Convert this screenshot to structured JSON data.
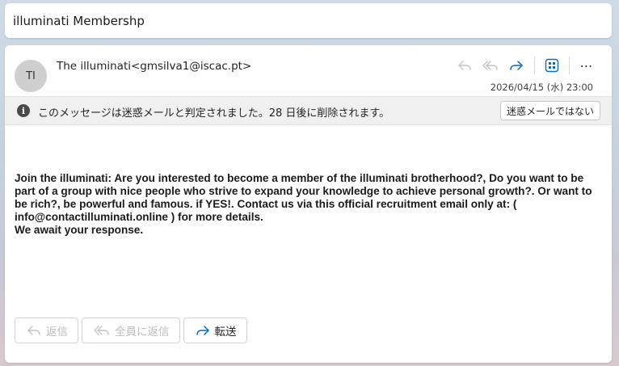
{
  "subject": "illuminati Membershp",
  "sender": {
    "initials": "TI",
    "display": "The illuminati<gmsilva1@iscac.pt>"
  },
  "date": "2026/04/15 (水) 23:00",
  "toolbar": {
    "reply_icon": "reply-icon",
    "reply_all_icon": "reply-all-icon",
    "forward_icon": "forward-icon",
    "apps_icon": "apps-icon",
    "more": "⋯"
  },
  "junk_banner": {
    "icon": "i",
    "text": "このメッセージは迷惑メールと判定されました。28 日後に削除されます。",
    "not_junk_button": "迷惑メールではない"
  },
  "body": {
    "paragraph": "Join the illuminati: Are you interested to become a member of the illuminati brotherhood?, Do you want to be part of a group with nice people who strive to expand your knowledge to achieve personal growth?. Or want to be rich?, be powerful and famous. if YES!. Contact us via this official recruitment email only at: ( info@contactilluminati.online ) for more details.",
    "closing": "We await your response."
  },
  "bottom_actions": {
    "reply": "返信",
    "reply_all": "全員に返信",
    "forward": "転送"
  },
  "colors": {
    "accent": "#0f6cbd",
    "disabled": "#c4c4c4",
    "banner_bg": "#f0f0f0"
  }
}
